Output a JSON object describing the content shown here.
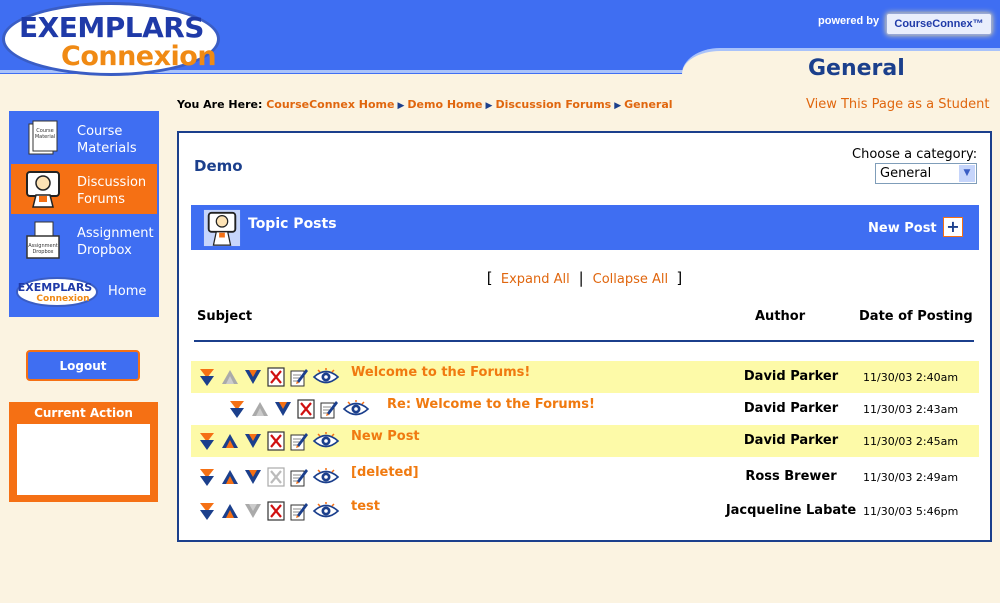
{
  "header": {
    "logo_top": "EXEMPLARS",
    "logo_bottom": "Connexion",
    "powered_by": "powered by",
    "badge": "CourseConnex™",
    "page_title": "General"
  },
  "breadcrumb": {
    "prefix": "You Are Here:",
    "items": [
      "CourseConnex Home",
      "Demo Home",
      "Discussion Forums",
      "General"
    ]
  },
  "student_view_link": "View This Page as a Student",
  "nav": {
    "items": [
      {
        "label_line1": "Course",
        "label_line2": "Materials",
        "icon": "book-icon"
      },
      {
        "label_line1": "Discussion",
        "label_line2": "Forums",
        "icon": "forum-person-icon"
      },
      {
        "label_line1": "Assignment",
        "label_line2": "Dropbox",
        "icon": "dropbox-icon"
      },
      {
        "label_line1": "Home",
        "label_line2": "",
        "icon": "exemplars-logo-icon"
      }
    ],
    "active_index": 1
  },
  "logout_label": "Logout",
  "current_action": {
    "title": "Current Action",
    "content": ""
  },
  "panel": {
    "title": "Demo",
    "category_label": "Choose a category:",
    "category_selected": "General",
    "topic_bar_title": "Topic Posts",
    "new_post_label": "New Post",
    "expand_all": "Expand All",
    "collapse_all": "Collapse All",
    "columns": {
      "subject": "Subject",
      "author": "Author",
      "date": "Date of Posting"
    }
  },
  "posts": [
    {
      "subject": "Welcome to the Forums!",
      "author": "David Parker",
      "date": "11/30/03 2:40am",
      "indent": 0,
      "highlight": true,
      "up_enabled": false,
      "down_enabled": true,
      "delete_enabled": true
    },
    {
      "subject": "Re: Welcome to the Forums!",
      "author": "David Parker",
      "date": "11/30/03 2:43am",
      "indent": 1,
      "highlight": false,
      "up_enabled": false,
      "down_enabled": true,
      "delete_enabled": true
    },
    {
      "subject": "New Post",
      "author": "David Parker",
      "date": "11/30/03 2:45am",
      "indent": 0,
      "highlight": true,
      "up_enabled": true,
      "down_enabled": true,
      "delete_enabled": true
    },
    {
      "subject": "[deleted]",
      "author": "Ross Brewer",
      "date": "11/30/03 2:49am",
      "indent": 0,
      "highlight": false,
      "up_enabled": true,
      "down_enabled": true,
      "delete_enabled": false
    },
    {
      "subject": "test",
      "author": "Jacqueline Labate",
      "date": "11/30/03 5:46pm",
      "indent": 0,
      "highlight": false,
      "up_enabled": true,
      "down_enabled": false,
      "delete_enabled": true
    }
  ],
  "colors": {
    "brand_blue": "#3f6ef2",
    "navy": "#1b3f8c",
    "orange": "#f57014",
    "link_orange": "#e0660e",
    "highlight_yellow": "#fdfaa8",
    "page_bg": "#fbf3e1"
  }
}
